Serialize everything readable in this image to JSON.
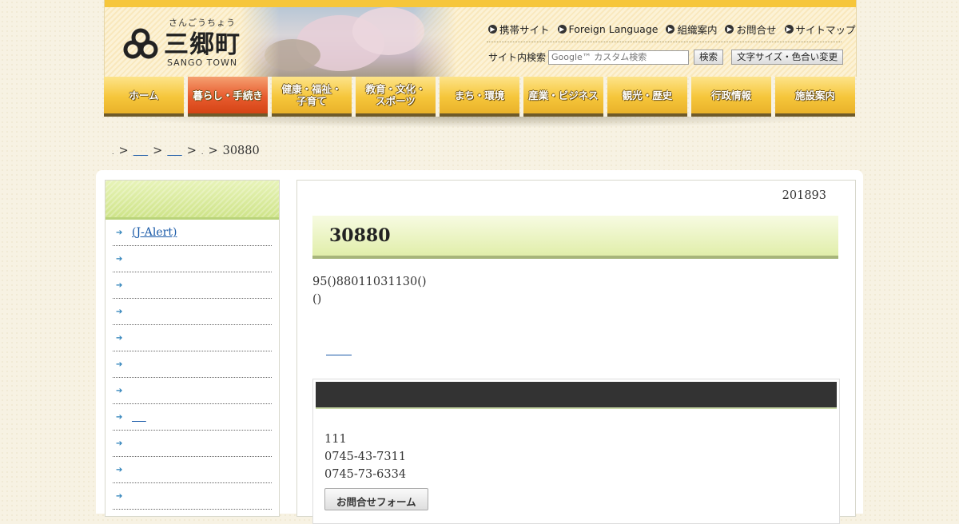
{
  "logo": {
    "kana": "さんごうちょう",
    "kanji": "三郷町",
    "roman": "SANGO TOWN"
  },
  "util_links": [
    {
      "label": "携帯サイト",
      "icon": "arrow-right-circle-icon"
    },
    {
      "label": "Foreign Language",
      "icon": "arrow-right-circle-icon"
    },
    {
      "label": "組織案内",
      "icon": "arrow-right-circle-icon"
    },
    {
      "label": "お問合せ",
      "icon": "arrow-right-circle-icon"
    },
    {
      "label": "サイトマップ",
      "icon": "arrow-right-circle-icon"
    }
  ],
  "search": {
    "label": "サイト内検索",
    "placeholder": "Google™ カスタム検索",
    "button": "検索"
  },
  "text_size_button": "文字サイズ・色合い変更",
  "gnav": [
    {
      "label": "ホーム"
    },
    {
      "label": "暮らし・手続き",
      "active": true
    },
    {
      "label": "健康・福祉・\n子育て"
    },
    {
      "label": "教育・文化・\nスポーツ"
    },
    {
      "label": "まち・環境"
    },
    {
      "label": "産業・ビジネス"
    },
    {
      "label": "観光・歴史"
    },
    {
      "label": "行政情報"
    },
    {
      "label": "施設案内"
    }
  ],
  "breadcrumb": {
    "sep1": ">",
    "sep2": ">",
    "sep3": ">",
    "sep4": ">",
    "dot1": ".",
    "dot2": ".",
    "current": "30880"
  },
  "sidebar": {
    "items": [
      {
        "label": "(J-Alert)",
        "link": true
      },
      {
        "label": ""
      },
      {
        "label": ""
      },
      {
        "label": ""
      },
      {
        "label": ""
      },
      {
        "label": ""
      },
      {
        "label": ""
      },
      {
        "label": "",
        "link": true
      },
      {
        "label": ""
      },
      {
        "label": ""
      },
      {
        "label": ""
      }
    ],
    "bullet": "➔"
  },
  "content": {
    "update_date": "201893",
    "title": "30880",
    "body_line1": "95()88011031130()",
    "body_line2": "()"
  },
  "contact": {
    "line1": "111",
    "phone": "0745-43-7311",
    "fax": "0745-73-6334",
    "form_button": "お問合せフォーム"
  },
  "colors": {
    "nav_yellow": "#f6c63b",
    "nav_active": "#e75b2e",
    "title_green": "#e1eeaa",
    "link_blue": "#1a5aa8"
  }
}
